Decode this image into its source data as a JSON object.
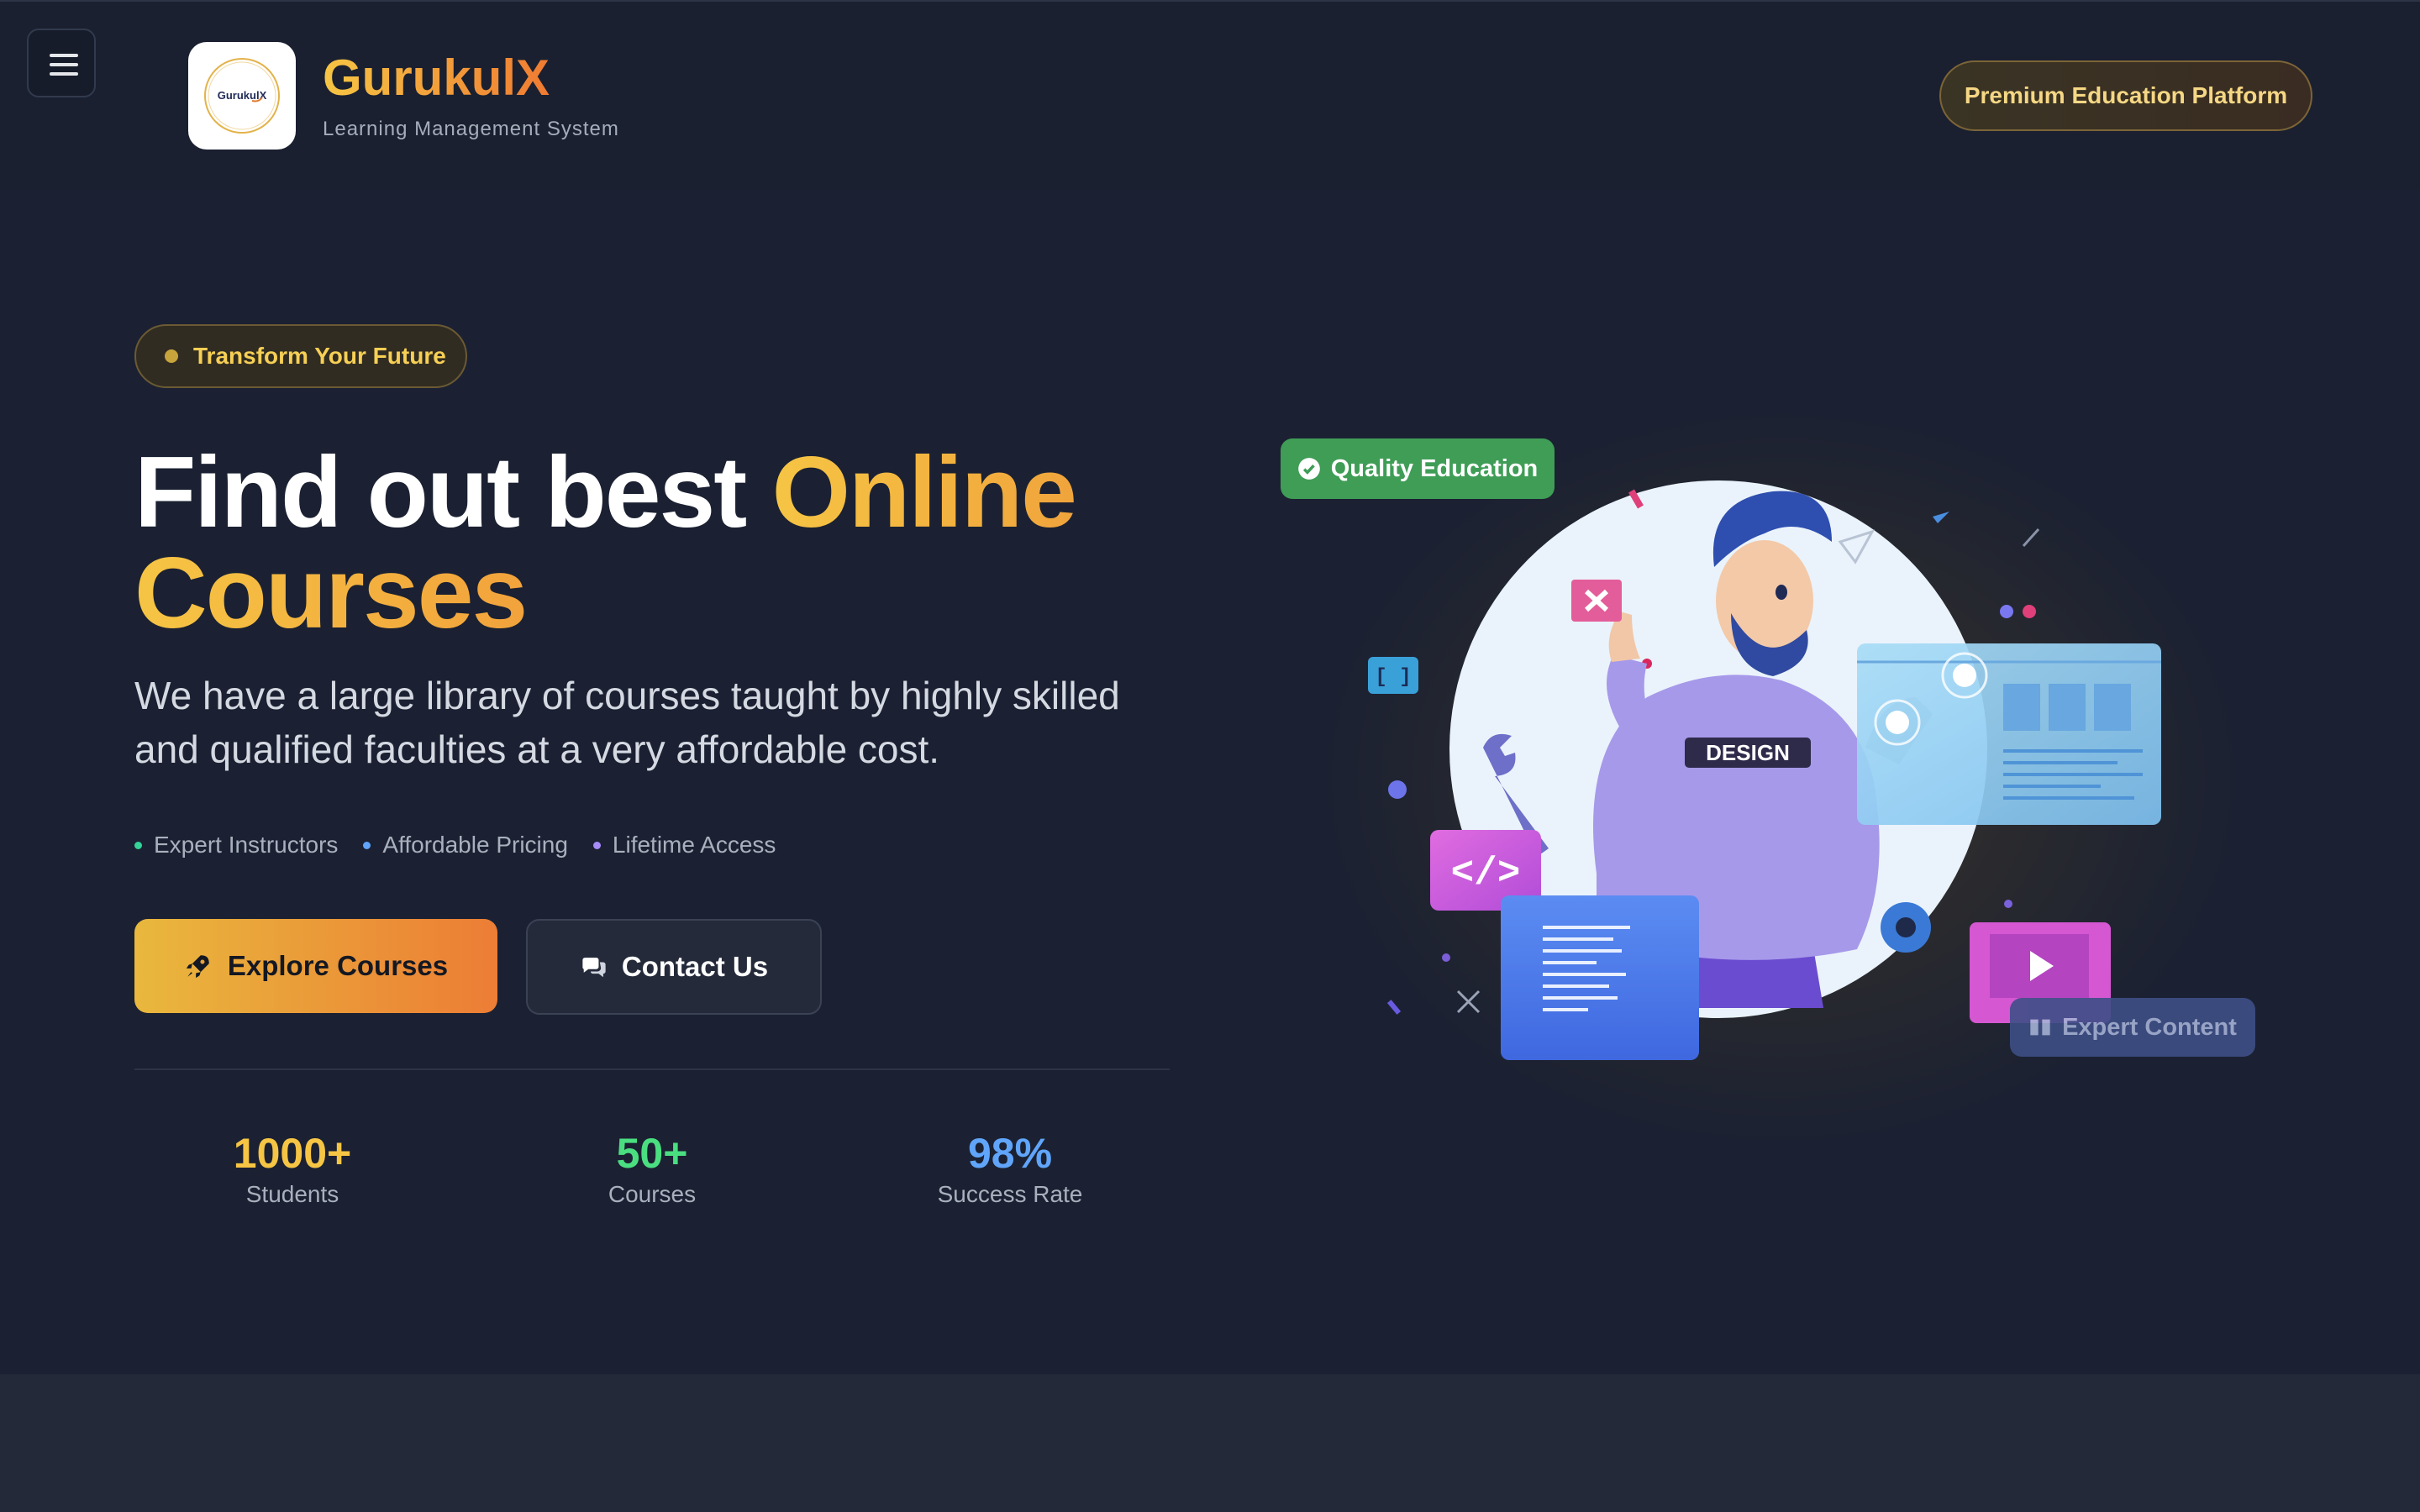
{
  "header": {
    "brand_name": "GurukulX",
    "brand_subtitle": "Learning Management System",
    "logo_text": "GurukulX",
    "badge": "Premium Education Platform"
  },
  "hero": {
    "tagline": "Transform Your Future",
    "headline_part1": "Find out best ",
    "headline_accent": "Online",
    "headline_line2": "Courses",
    "description": "We have a large library of courses taught by highly skilled and qualified faculties at a very affordable cost.",
    "features": [
      {
        "label": "Expert Instructors",
        "color": "#34d399"
      },
      {
        "label": "Affordable Pricing",
        "color": "#60a5fa"
      },
      {
        "label": "Lifetime Access",
        "color": "#a78bfa"
      }
    ],
    "primary_button": "Explore Courses",
    "secondary_button": "Contact Us",
    "stats": [
      {
        "value": "1000+",
        "label": "Students",
        "color": "#f6c544"
      },
      {
        "value": "50+",
        "label": "Courses",
        "color": "#4ade80"
      },
      {
        "value": "98%",
        "label": "Success Rate",
        "color": "#60a5fa"
      }
    ]
  },
  "illustration": {
    "quality_badge": "Quality Education",
    "expert_badge": "Expert Content",
    "shirt_text": "DESIGN",
    "code_tag": "</>",
    "brackets": "[ ]"
  },
  "colors": {
    "accent_yellow": "#f6c544",
    "accent_orange": "#ef7b32",
    "background": "#1b2132",
    "quality_green": "#3f9d56"
  }
}
